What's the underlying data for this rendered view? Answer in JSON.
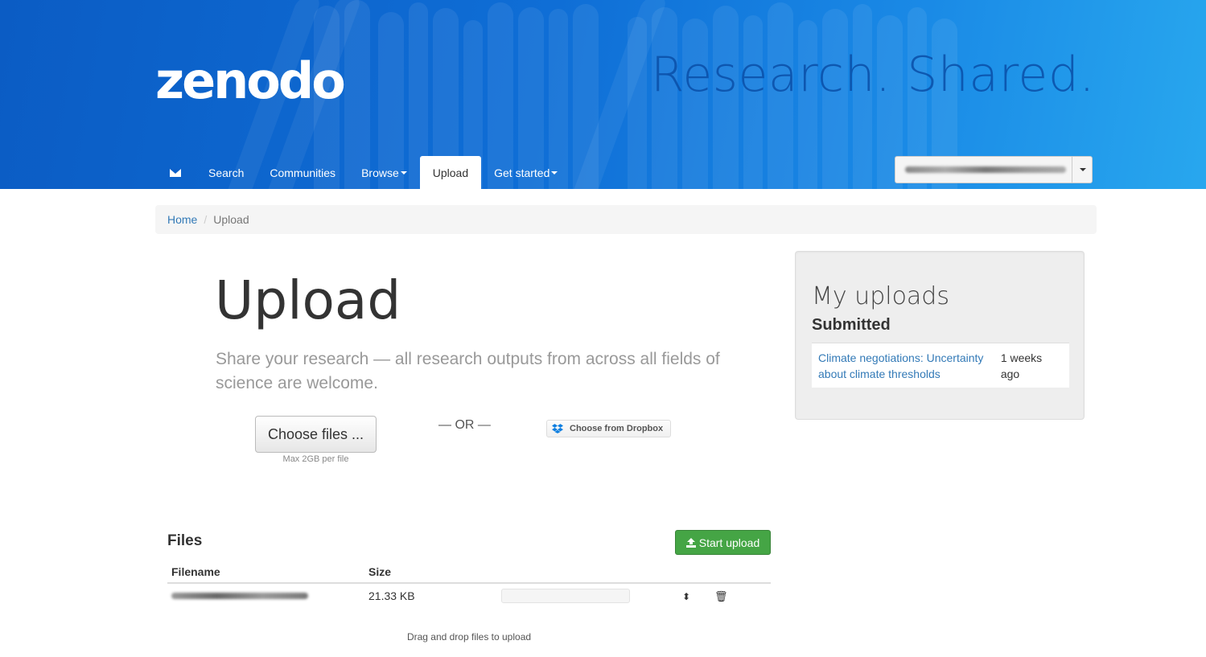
{
  "brand": {
    "logo": "zenodo",
    "tagline": "Research. Shared."
  },
  "nav": {
    "items": [
      {
        "label": "Search"
      },
      {
        "label": "Communities"
      },
      {
        "label": "Browse"
      },
      {
        "label": "Upload",
        "active": true
      },
      {
        "label": "Get started"
      }
    ]
  },
  "breadcrumb": {
    "home": "Home",
    "current": "Upload"
  },
  "main": {
    "title": "Upload",
    "lead": "Share your research — all research outputs from across all fields of science are welcome.",
    "choose_files": "Choose files ...",
    "max_note": "Max 2GB per file",
    "or": "— OR —",
    "dropbox": "Choose from Dropbox"
  },
  "files": {
    "title": "Files",
    "start_upload": "Start upload",
    "columns": [
      "Filename",
      "Size"
    ],
    "rows": [
      {
        "size": "21.33 KB"
      }
    ],
    "drag_drop": "Drag and drop files to upload"
  },
  "sidebar": {
    "title": "My uploads",
    "subtitle": "Submitted",
    "items": [
      {
        "title": "Climate negotiations: Uncertainty about climate thresholds",
        "date": "1 weeks ago"
      }
    ]
  },
  "colors": {
    "header_blue": "#0f6ed6",
    "link": "#337ab7",
    "success": "#45a545"
  }
}
